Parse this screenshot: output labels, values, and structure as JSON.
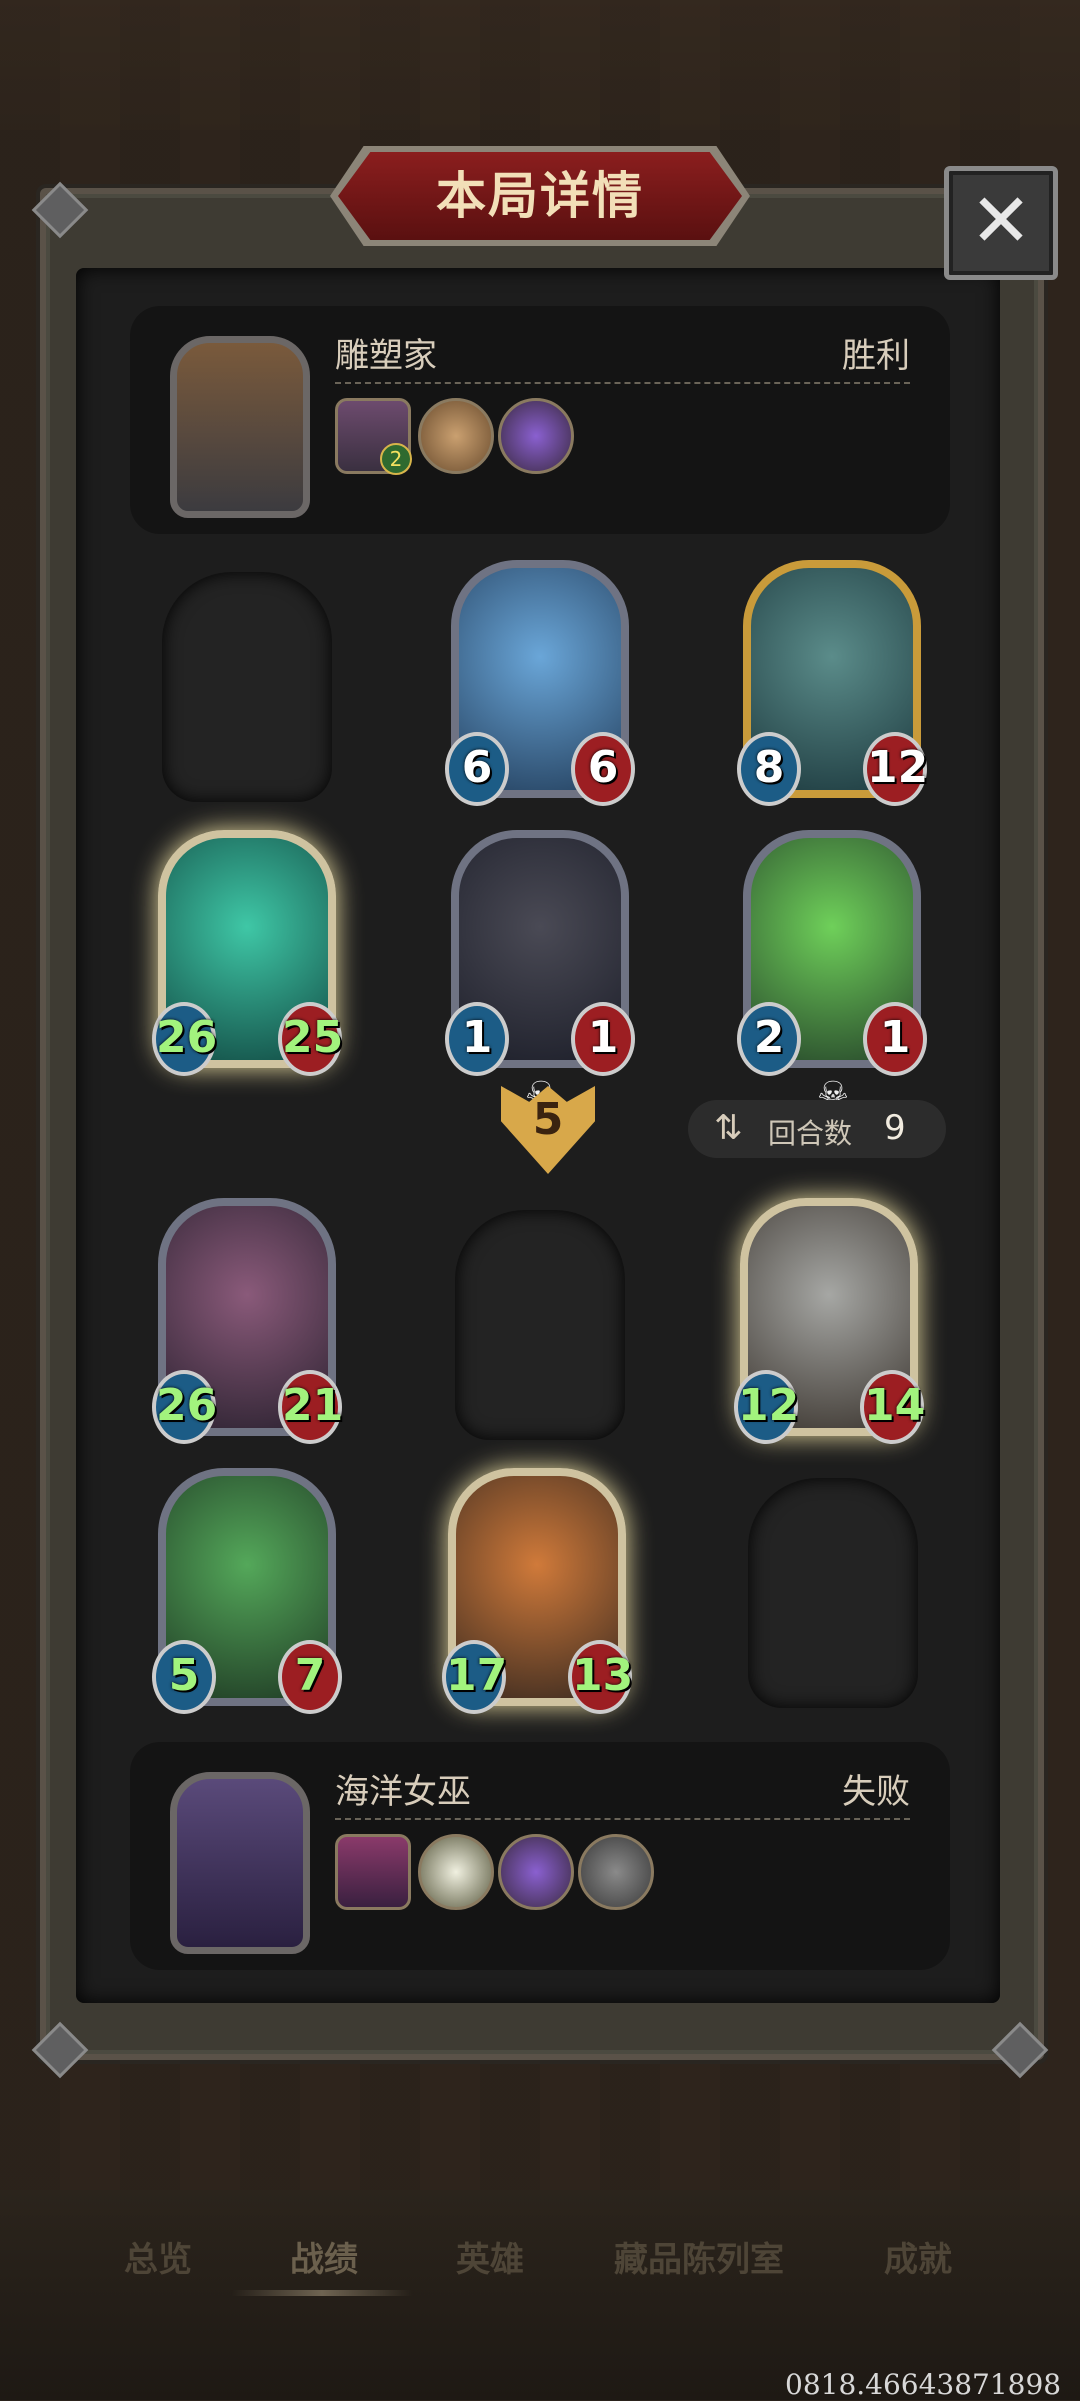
{
  "dialog": {
    "title": "本局详情",
    "close_icon": "✕"
  },
  "top_player": {
    "name": "雕塑家",
    "result": "胜利",
    "hero_level_badge": "2",
    "icons": [
      "hero-portrait-icon",
      "trinket-icon",
      "gem-icon"
    ]
  },
  "bottom_player": {
    "name": "海洋女巫",
    "result": "失败",
    "icons": [
      "hero-portrait-icon",
      "spell-icon",
      "gem-icon",
      "pot-icon"
    ]
  },
  "top_board": [
    {
      "slot": "empty"
    },
    {
      "atk": "6",
      "hp": "6"
    },
    {
      "atk": "8",
      "hp": "12"
    },
    {
      "atk": "26",
      "hp": "25"
    },
    {
      "atk": "1",
      "hp": "1",
      "dead": true
    },
    {
      "atk": "2",
      "hp": "1",
      "dead": true
    }
  ],
  "bottom_board": [
    {
      "atk": "26",
      "hp": "21"
    },
    {
      "slot": "empty"
    },
    {
      "atk": "12",
      "hp": "14"
    },
    {
      "atk": "5",
      "hp": "7"
    },
    {
      "atk": "17",
      "hp": "13"
    },
    {
      "slot": "empty"
    }
  ],
  "damage": {
    "value": "5"
  },
  "rounds": {
    "label": "回合数",
    "value": "9"
  },
  "nav": {
    "items": [
      "总览",
      "战绩",
      "英雄",
      "藏品陈列室",
      "成就"
    ],
    "active": "战绩"
  },
  "watermark": "0818.46643871898",
  "colors": {
    "accent_gold": "#d8a84a",
    "title_red": "#8b1e1e",
    "hp_red": "#9c1e22",
    "atk_blue": "#1c5c86"
  }
}
